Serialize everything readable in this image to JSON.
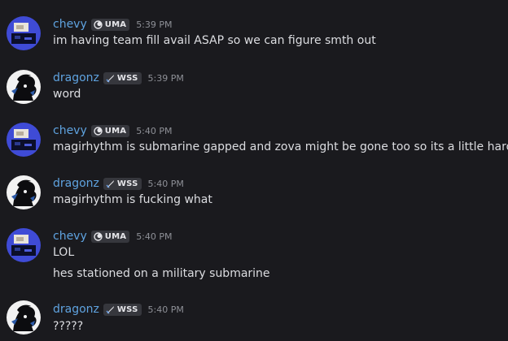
{
  "messages": [
    {
      "user": "chevy",
      "tag": "UMA",
      "tag_icon": "moon-icon",
      "avatar_icon": "chevy-avatar-icon",
      "time": "5:39 PM",
      "lines": [
        "im having team fill avail ASAP so we can figure smth out"
      ]
    },
    {
      "user": "dragonz",
      "tag": "WSS",
      "tag_icon": "sword-icon",
      "avatar_icon": "dragonz-avatar-icon",
      "time": "5:39 PM",
      "lines": [
        "word"
      ]
    },
    {
      "user": "chevy",
      "tag": "UMA",
      "tag_icon": "moon-icon",
      "avatar_icon": "chevy-avatar-icon",
      "time": "5:40 PM",
      "lines": [
        "magirhythm is submarine gapped and zova might be gone too so its a little hard"
      ]
    },
    {
      "user": "dragonz",
      "tag": "WSS",
      "tag_icon": "sword-icon",
      "avatar_icon": "dragonz-avatar-icon",
      "time": "5:40 PM",
      "lines": [
        "magirhythm is fucking what"
      ]
    },
    {
      "user": "chevy",
      "tag": "UMA",
      "tag_icon": "moon-icon",
      "avatar_icon": "chevy-avatar-icon",
      "time": "5:40 PM",
      "lines": [
        "LOL",
        "hes stationed on a military submarine"
      ]
    },
    {
      "user": "dragonz",
      "tag": "WSS",
      "tag_icon": "sword-icon",
      "avatar_icon": "dragonz-avatar-icon",
      "time": "5:40 PM",
      "lines": [
        "?????"
      ]
    }
  ],
  "colors": {
    "background": "#1a1a1e",
    "username": "#5fa3e0",
    "timestamp": "#8e9097",
    "message_text": "#dcdde1",
    "tag_background": "#36373d",
    "avatar_chevy_bg": "#3f4bd6",
    "avatar_dragonz_bg": "#f2f2f2"
  }
}
